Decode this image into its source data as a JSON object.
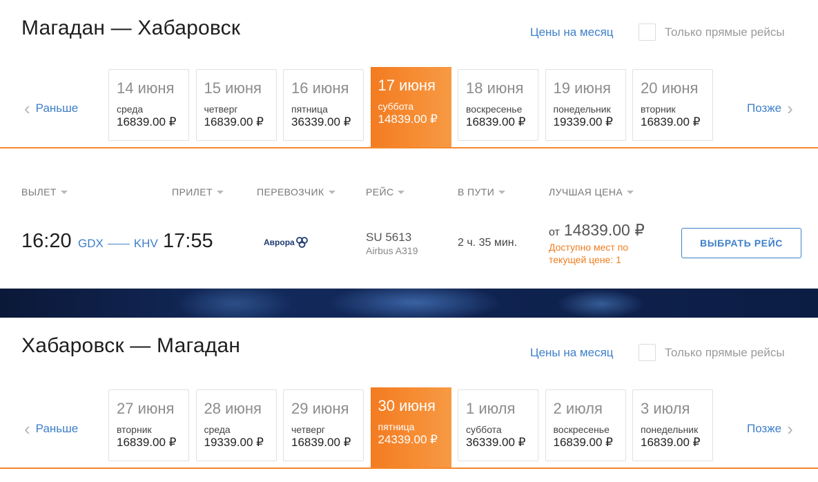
{
  "outbound": {
    "route_title": "Магадан — Хабаровск",
    "month_prices_link": "Цены на месяц",
    "direct_only_label": "Только прямые рейсы",
    "nav_prev": "Раньше",
    "nav_next": "Позже",
    "dates": [
      {
        "date": "14 июня",
        "weekday": "среда",
        "price": "16839.00 ₽",
        "selected": false
      },
      {
        "date": "15 июня",
        "weekday": "четверг",
        "price": "16839.00 ₽",
        "selected": false
      },
      {
        "date": "16 июня",
        "weekday": "пятница",
        "price": "36339.00 ₽",
        "selected": false
      },
      {
        "date": "17 июня",
        "weekday": "суббота",
        "price": "14839.00 ₽",
        "selected": true
      },
      {
        "date": "18 июня",
        "weekday": "воскресенье",
        "price": "16839.00 ₽",
        "selected": false
      },
      {
        "date": "19 июня",
        "weekday": "понедельник",
        "price": "19339.00 ₽",
        "selected": false
      },
      {
        "date": "20 июня",
        "weekday": "вторник",
        "price": "16839.00 ₽",
        "selected": false
      }
    ],
    "columns": {
      "departure": "ВЫЛЕТ",
      "arrival": "ПРИЛЕТ",
      "carrier": "ПЕРЕВОЗЧИК",
      "flight": "РЕЙС",
      "in_flight": "В ПУТИ",
      "best_price": "ЛУЧШАЯ ЦЕНА"
    },
    "flight": {
      "depart_time": "16:20",
      "from_code": "GDX",
      "to_code": "KHV",
      "arrive_time": "17:55",
      "airline": "Аврора",
      "flight_number": "SU 5613",
      "aircraft": "Airbus A319",
      "duration": "2 ч. 35 мин.",
      "price_prefix": "от",
      "price": "14839.00 ₽",
      "seats_note": "Доступно мест по текущей цене: 1",
      "select_button": "ВЫБРАТЬ РЕЙС"
    }
  },
  "return": {
    "route_title": "Хабаровск — Магадан",
    "month_prices_link": "Цены на месяц",
    "direct_only_label": "Только прямые рейсы",
    "nav_prev": "Раньше",
    "nav_next": "Позже",
    "dates": [
      {
        "date": "27 июня",
        "weekday": "вторник",
        "price": "16839.00 ₽",
        "selected": false
      },
      {
        "date": "28 июня",
        "weekday": "среда",
        "price": "19339.00 ₽",
        "selected": false
      },
      {
        "date": "29 июня",
        "weekday": "четверг",
        "price": "16839.00 ₽",
        "selected": false
      },
      {
        "date": "30 июня",
        "weekday": "пятница",
        "price": "24339.00 ₽",
        "selected": true
      },
      {
        "date": "1 июля",
        "weekday": "суббота",
        "price": "36339.00 ₽",
        "selected": false
      },
      {
        "date": "2 июля",
        "weekday": "воскресенье",
        "price": "16839.00 ₽",
        "selected": false
      },
      {
        "date": "3 июля",
        "weekday": "понедельник",
        "price": "16839.00 ₽",
        "selected": false
      }
    ]
  },
  "colors": {
    "accent_blue": "#3d7fc9",
    "accent_orange": "#f47b20",
    "seats_orange": "#ef7d1e"
  },
  "icons": {
    "nav_prev": "chevron-left-icon",
    "nav_next": "chevron-right-icon",
    "sort": "caret-down-icon"
  }
}
